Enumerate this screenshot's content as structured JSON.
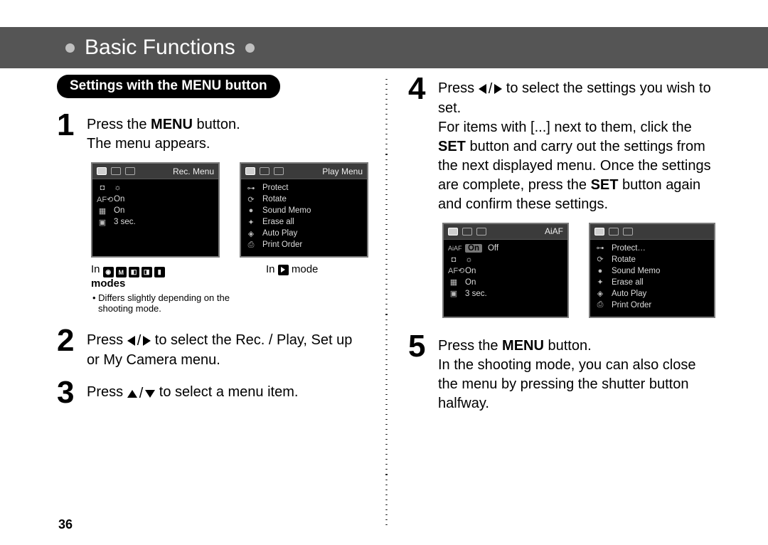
{
  "header": {
    "chapter": "Basic Functions"
  },
  "page_number": "36",
  "section": {
    "title": "Settings with the MENU button"
  },
  "steps": {
    "s1": {
      "num": "1",
      "a": "Press the ",
      "b": "MENU",
      "c": " button.",
      "d": "The menu appears."
    },
    "s2": {
      "num": "2",
      "text_a": "Press ",
      "text_b": " to select the Rec. / Play, Set up or My Camera menu."
    },
    "s3": {
      "num": "3",
      "text_a": "Press ",
      "text_b": " to select a menu item."
    },
    "s4": {
      "num": "4",
      "a": "Press ",
      "b": " to select the settings you wish to set.",
      "c": "For items with [...] next to them, click the ",
      "d": "SET",
      "e": " button and carry out the settings from the next displayed menu.  Once the settings are complete, press the ",
      "f": "SET",
      "g": " button again and confirm these settings."
    },
    "s5": {
      "num": "5",
      "a": "Press the ",
      "b": "MENU",
      "c": " button.",
      "d": "In the shooting mode, you can also close the menu by pressing the shutter button halfway."
    }
  },
  "lcd_rec": {
    "title": "Rec. Menu",
    "rows": [
      {
        "ic": "◘",
        "val": "☼"
      },
      {
        "ic": "AF⟲",
        "val": "On"
      },
      {
        "ic": "▦",
        "val": "On"
      },
      {
        "ic": "▣",
        "val": "3 sec."
      }
    ]
  },
  "lcd_play": {
    "title": "Play Menu",
    "rows": [
      {
        "ic": "⊶",
        "val": "Protect"
      },
      {
        "ic": "⟳",
        "val": "Rotate"
      },
      {
        "ic": "●",
        "val": "Sound Memo"
      },
      {
        "ic": "✦",
        "val": "Erase all"
      },
      {
        "ic": "◈",
        "val": "Auto Play"
      },
      {
        "ic": "⎙",
        "val": "Print Order"
      }
    ]
  },
  "lcd_aiaf": {
    "title": "AiAF",
    "rows": [
      {
        "ic": "AiAF",
        "on": "On",
        "off": "Off"
      },
      {
        "ic": "◘",
        "val": "☼"
      },
      {
        "ic": "AF⟲",
        "val": "On"
      },
      {
        "ic": "▦",
        "val": "On"
      },
      {
        "ic": "▣",
        "val": "3 sec."
      }
    ]
  },
  "lcd_play2": {
    "title": "",
    "rows": [
      {
        "ic": "⊶",
        "val": "Protect…"
      },
      {
        "ic": "⟳",
        "val": "Rotate"
      },
      {
        "ic": "●",
        "val": "Sound Memo"
      },
      {
        "ic": "✦",
        "val": "Erase all"
      },
      {
        "ic": "◈",
        "val": "Auto Play"
      },
      {
        "ic": "⎙",
        "val": "Print Order"
      }
    ]
  },
  "captions": {
    "left_in": "In ",
    "left_modes": "modes",
    "left_note": "• Differs slightly depending on the shooting mode.",
    "right_in": "In ",
    "right_mode": " mode"
  }
}
